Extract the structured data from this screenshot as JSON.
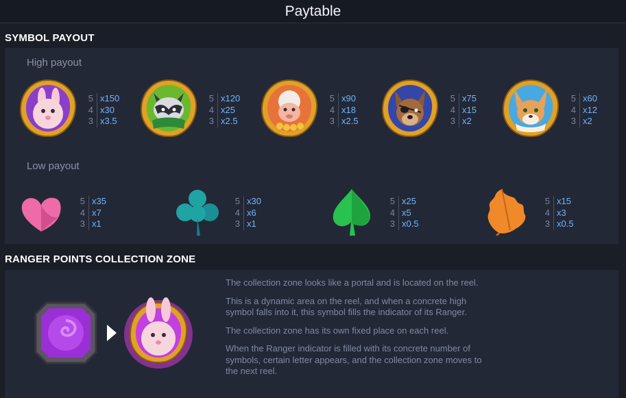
{
  "title": "Paytable",
  "symbol_payout": {
    "heading": "SYMBOL PAYOUT",
    "high_label": "High payout",
    "low_label": "Low payout",
    "high": [
      {
        "icon": "bunny-ranger-icon",
        "payouts": [
          {
            "count": "5",
            "value": "x150"
          },
          {
            "count": "4",
            "value": "x30"
          },
          {
            "count": "3",
            "value": "x3.5"
          }
        ]
      },
      {
        "icon": "raccoon-ranger-icon",
        "payouts": [
          {
            "count": "5",
            "value": "x120"
          },
          {
            "count": "4",
            "value": "x25"
          },
          {
            "count": "3",
            "value": "x2.5"
          }
        ]
      },
      {
        "icon": "monkey-ranger-icon",
        "payouts": [
          {
            "count": "5",
            "value": "x90"
          },
          {
            "count": "4",
            "value": "x18"
          },
          {
            "count": "3",
            "value": "x2.5"
          }
        ]
      },
      {
        "icon": "dog-pirate-ranger-icon",
        "payouts": [
          {
            "count": "5",
            "value": "x75"
          },
          {
            "count": "4",
            "value": "x15"
          },
          {
            "count": "3",
            "value": "x2"
          }
        ]
      },
      {
        "icon": "fox-ranger-icon",
        "payouts": [
          {
            "count": "5",
            "value": "x60"
          },
          {
            "count": "4",
            "value": "x12"
          },
          {
            "count": "3",
            "value": "x2"
          }
        ]
      }
    ],
    "low": [
      {
        "icon": "pink-heart-leaf-icon",
        "color": "#ee6aa8",
        "payouts": [
          {
            "count": "5",
            "value": "x35"
          },
          {
            "count": "4",
            "value": "x7"
          },
          {
            "count": "3",
            "value": "x1"
          }
        ]
      },
      {
        "icon": "teal-clover-leaf-icon",
        "color": "#1fa3a3",
        "payouts": [
          {
            "count": "5",
            "value": "x30"
          },
          {
            "count": "4",
            "value": "x6"
          },
          {
            "count": "3",
            "value": "x1"
          }
        ]
      },
      {
        "icon": "green-spade-leaf-icon",
        "color": "#28c24d",
        "payouts": [
          {
            "count": "5",
            "value": "x25"
          },
          {
            "count": "4",
            "value": "x5"
          },
          {
            "count": "3",
            "value": "x0.5"
          }
        ]
      },
      {
        "icon": "orange-oak-leaf-icon",
        "color": "#f0892a",
        "payouts": [
          {
            "count": "5",
            "value": "x15"
          },
          {
            "count": "4",
            "value": "x3"
          },
          {
            "count": "3",
            "value": "x0.5"
          }
        ]
      }
    ]
  },
  "collection_zone": {
    "heading": "RANGER POINTS COLLECTION ZONE",
    "paragraphs": [
      "The collection zone looks like a portal and is located on the reel.",
      "This is a dynamic area on the reel, and when a concrete high symbol falls into it, this symbol fills the indicator of its Ranger.",
      "The collection zone has its own fixed place on each reel.",
      "When the Ranger indicator is filled with its concrete number of symbols, certain letter appears, and the collection zone moves to the next reel."
    ],
    "portal_icon": "purple-portal-icon",
    "arrow_icon": "play-arrow-icon",
    "result_icon": "glowing-bunny-ranger-icon"
  },
  "colors": {
    "background": "#1a1e27",
    "panel": "#232836",
    "payout_value": "#6fb6ff",
    "gold_frame": "#e0a128"
  }
}
